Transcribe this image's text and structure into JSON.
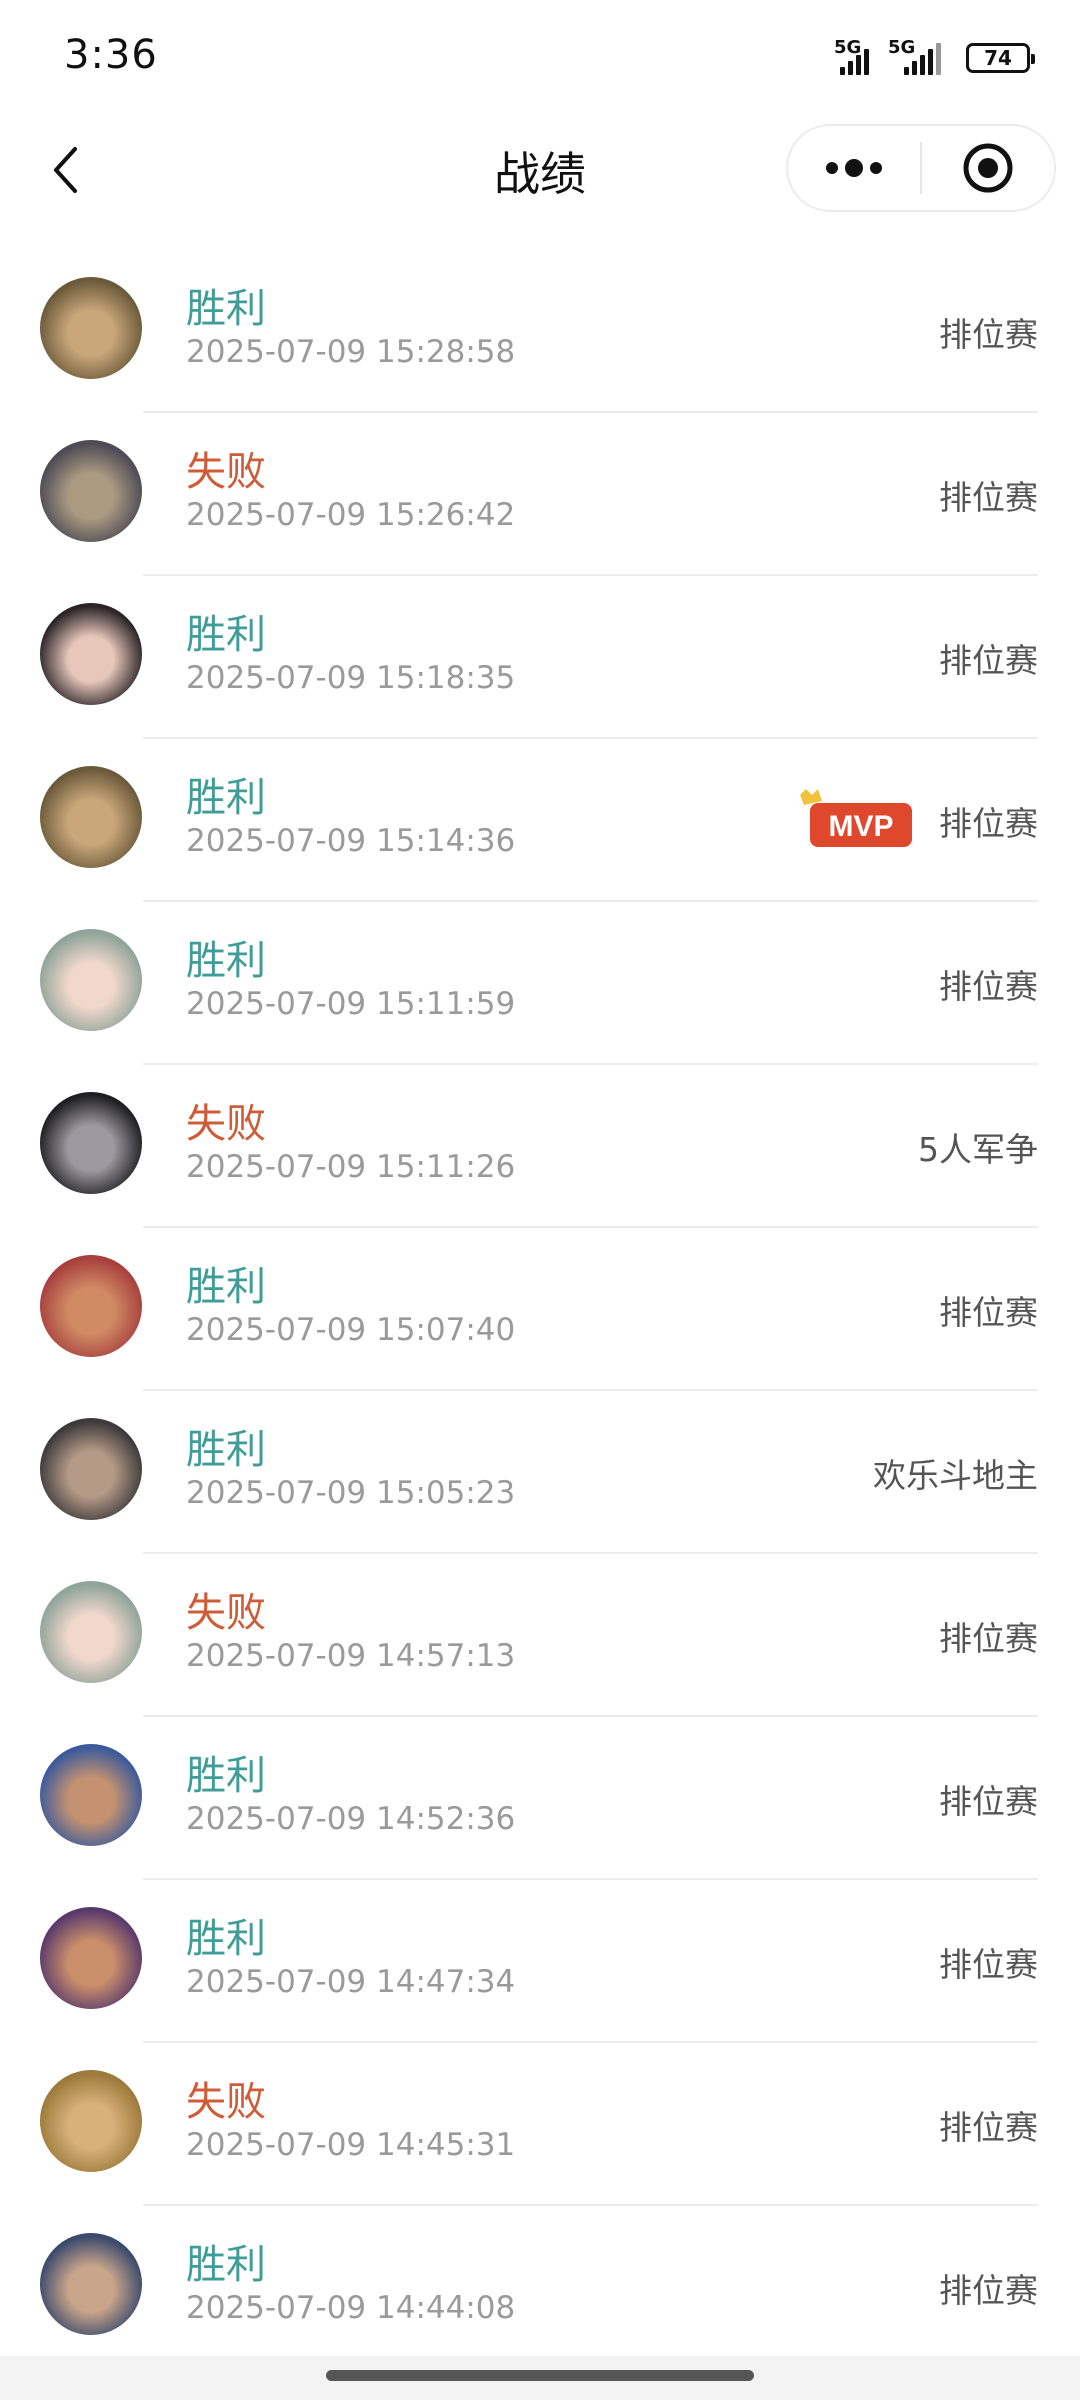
{
  "status_bar": {
    "time": "3:36",
    "network1": "5G",
    "network2": "5G",
    "battery": "74"
  },
  "nav": {
    "title": "战绩"
  },
  "records": [
    {
      "result": "胜利",
      "type": "win",
      "time": "2025-07-09 15:28:58",
      "mode": "排位赛",
      "mvp": false,
      "colors": [
        "#6b5a3a",
        "#c9a77a"
      ]
    },
    {
      "result": "失败",
      "type": "lose",
      "time": "2025-07-09 15:26:42",
      "mode": "排位赛",
      "mvp": false,
      "colors": [
        "#4d4a55",
        "#a99a80"
      ]
    },
    {
      "result": "胜利",
      "type": "win",
      "time": "2025-07-09 15:18:35",
      "mode": "排位赛",
      "mvp": false,
      "colors": [
        "#2a2428",
        "#e7c7b9"
      ]
    },
    {
      "result": "胜利",
      "type": "win",
      "time": "2025-07-09 15:14:36",
      "mode": "排位赛",
      "mvp": true,
      "mvp_label": "MVP",
      "colors": [
        "#6b5a3a",
        "#c9a77a"
      ]
    },
    {
      "result": "胜利",
      "type": "win",
      "time": "2025-07-09 15:11:59",
      "mode": "排位赛",
      "mvp": false,
      "colors": [
        "#8fa49a",
        "#f1d8cc"
      ]
    },
    {
      "result": "失败",
      "type": "lose",
      "time": "2025-07-09 15:11:26",
      "mode": "5人军争",
      "mvp": false,
      "colors": [
        "#1f1e20",
        "#9c9aa0"
      ]
    },
    {
      "result": "胜利",
      "type": "win",
      "time": "2025-07-09 15:07:40",
      "mode": "排位赛",
      "mvp": false,
      "colors": [
        "#a8403e",
        "#d08b65"
      ]
    },
    {
      "result": "胜利",
      "type": "win",
      "time": "2025-07-09 15:05:23",
      "mode": "欢乐斗地主",
      "mvp": false,
      "colors": [
        "#3c3a3c",
        "#b59a86"
      ]
    },
    {
      "result": "失败",
      "type": "lose",
      "time": "2025-07-09 14:57:13",
      "mode": "排位赛",
      "mvp": false,
      "colors": [
        "#8fa49a",
        "#f1d8cc"
      ]
    },
    {
      "result": "胜利",
      "type": "win",
      "time": "2025-07-09 14:52:36",
      "mode": "排位赛",
      "mvp": false,
      "colors": [
        "#3b5a9c",
        "#c49270"
      ]
    },
    {
      "result": "胜利",
      "type": "win",
      "time": "2025-07-09 14:47:34",
      "mode": "排位赛",
      "mvp": false,
      "colors": [
        "#5a3a6c",
        "#c98e6a"
      ]
    },
    {
      "result": "失败",
      "type": "lose",
      "time": "2025-07-09 14:45:31",
      "mode": "排位赛",
      "mvp": false,
      "colors": [
        "#9c7a3a",
        "#d8b07a"
      ]
    },
    {
      "result": "胜利",
      "type": "win",
      "time": "2025-07-09 14:44:08",
      "mode": "排位赛",
      "mvp": false,
      "colors": [
        "#3a4a6c",
        "#c9a58a"
      ]
    }
  ]
}
